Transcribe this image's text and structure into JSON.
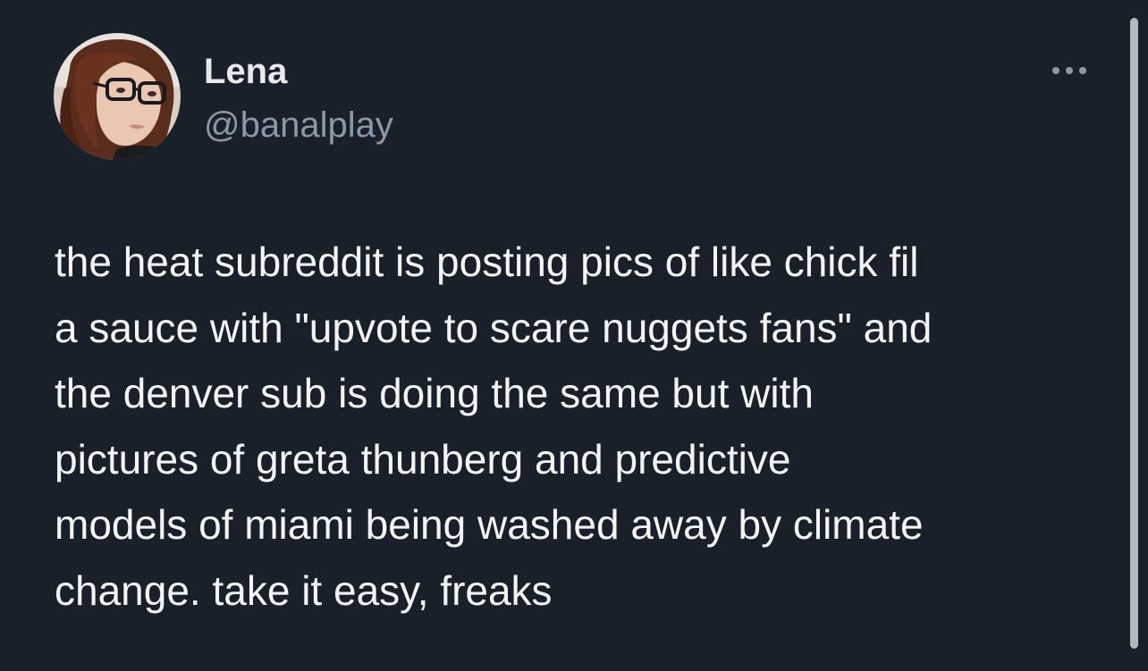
{
  "tweet": {
    "author": {
      "display_name": "Lena",
      "handle": "@banalplay"
    },
    "text": "the heat subreddit is posting pics of like chick fil\na sauce with \"upvote to scare nuggets fans\" and\nthe denver sub is doing the same but with\npictures of greta thunberg and predictive\nmodels of miami being washed away by climate\nchange. take it easy, freaks",
    "more_icon": "more-horizontal-icon"
  },
  "colors": {
    "background": "#1a202a",
    "text_primary": "#e7e9ea",
    "text_secondary": "#8b98a5",
    "scrollbar": "#b5b8bc"
  }
}
